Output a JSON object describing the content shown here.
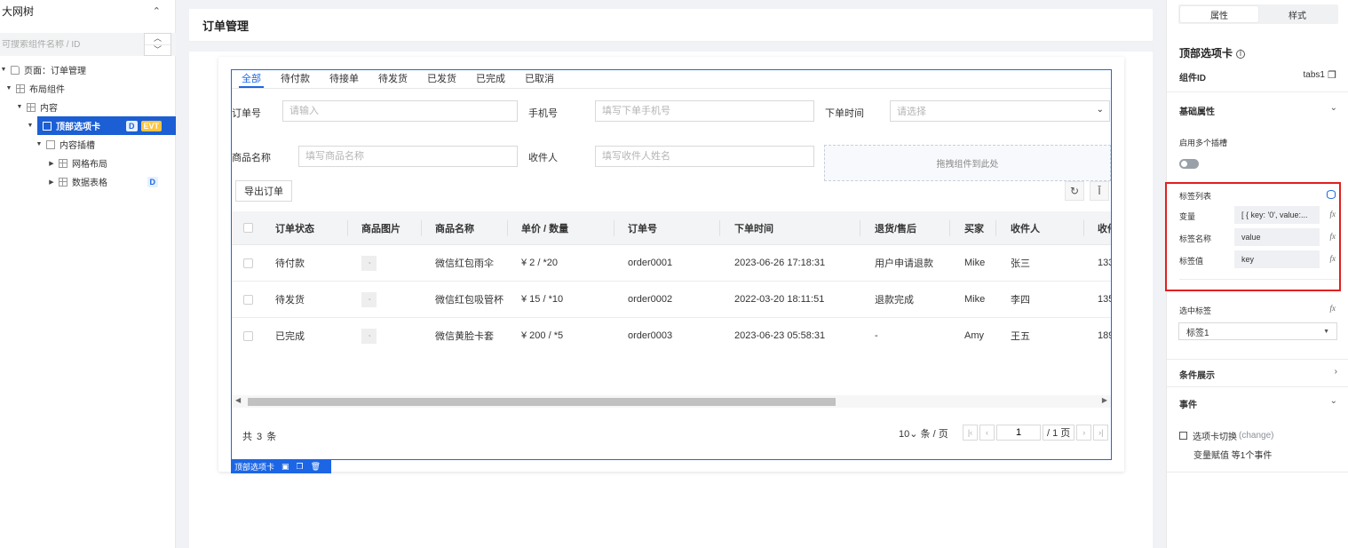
{
  "left_panel": {
    "title": "大网树",
    "search_placeholder": "可搜索组件名称 / ID",
    "tree": [
      {
        "label": "页面：订单管理",
        "indent": 0
      },
      {
        "label": "布局组件",
        "indent": 1
      },
      {
        "label": "内容",
        "indent": 2
      },
      {
        "label": "顶部选项卡",
        "indent": 3,
        "badges": [
          "D",
          "EVT"
        ]
      },
      {
        "label": "内容插槽",
        "indent": 4
      },
      {
        "label": "网格布局",
        "indent": 5
      },
      {
        "label": "数据表格",
        "indent": 5,
        "badges": [
          "D"
        ]
      }
    ]
  },
  "canvas": {
    "page_title": "订单管理",
    "tabs": [
      "全部",
      "待付款",
      "待接单",
      "待发货",
      "已发货",
      "已完成",
      "已取消"
    ],
    "active_tab": "全部",
    "form": {
      "order_no_label": "订单号",
      "order_no_placeholder": "请输入",
      "phone_label": "手机号",
      "phone_placeholder": "填写下单手机号",
      "time_label": "下单时间",
      "time_placeholder": "请选择",
      "product_label": "商品名称",
      "product_placeholder": "填写商品名称",
      "receiver_label": "收件人",
      "receiver_placeholder": "填写收件人姓名",
      "dropzone_text": "拖拽组件到此处"
    },
    "export_button": "导出订单",
    "table": {
      "columns": [
        "订单状态",
        "商品图片",
        "商品名称",
        "单价 / 数量",
        "订单号",
        "下单时间",
        "退货/售后",
        "买家",
        "收件人",
        "收件"
      ],
      "rows": [
        {
          "status": "待付款",
          "name": "微信红包雨伞",
          "price": "¥ 2 / *20",
          "order": "order0001",
          "time": "2023-06-26 17:18:31",
          "refund": "用户申请退款",
          "buyer": "Mike",
          "receiver": "张三",
          "phone": "133"
        },
        {
          "status": "待发货",
          "name": "微信红包吸管杯",
          "price": "¥ 15 / *10",
          "order": "order0002",
          "time": "2022-03-20 18:11:51",
          "refund": "退款完成",
          "buyer": "Mike",
          "receiver": "李四",
          "phone": "135"
        },
        {
          "status": "已完成",
          "name": "微信黄脸卡套",
          "price": "¥ 200 / *5",
          "order": "order0003",
          "time": "2023-06-23 05:58:31",
          "refund": "-",
          "buyer": "Amy",
          "receiver": "王五",
          "phone": "189"
        }
      ]
    },
    "footer": {
      "total": "共 3 条",
      "page_size": "10",
      "page_size_unit": "条 / 页",
      "current_page": "1",
      "total_pages": "/ 1 页"
    },
    "selection_toolbar_label": "顶部选项卡"
  },
  "right_panel": {
    "tabs": [
      "属性",
      "样式"
    ],
    "active_tab": "属性",
    "component_title": "顶部选项卡",
    "component_id_label": "组件ID",
    "component_id_value": "tabs1",
    "basic_section": "基础属性",
    "multi_tab_label": "启用多个插槽",
    "multi_tab_enabled": false,
    "tab_list_label": "标签列表",
    "variable_label": "变量",
    "variable_value": "[ { key: '0', value:...",
    "tab_name_label": "标签名称",
    "tab_name_value": "value",
    "tab_value_label": "标签值",
    "tab_value_value": "key",
    "selected_tab_label": "选中标签",
    "selected_tab_value": "标签1",
    "condition_section": "条件展示",
    "events_section": "事件",
    "event_name": "选项卡切换",
    "event_code": "(change)",
    "event_summary": "变量赋值 等1个事件",
    "fx_label": "fx",
    "highlight_color": "#e02020",
    "accent_color": "#1c66e5"
  }
}
